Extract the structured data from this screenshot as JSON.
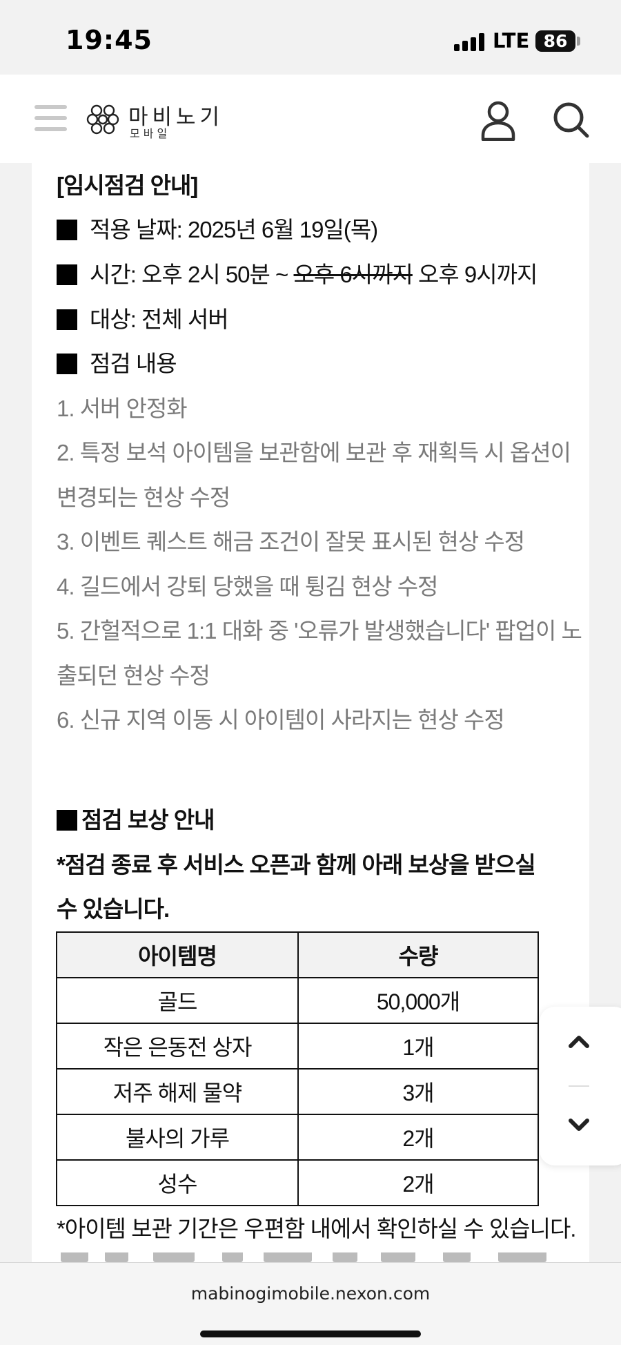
{
  "status": {
    "time": "19:45",
    "network": "LTE",
    "battery": "86"
  },
  "header": {
    "logo_title": "마비노기",
    "logo_subtitle": "모바일"
  },
  "notice": {
    "title": "[임시점검 안내]",
    "date_line": "적용 날짜: 2025년 6월 19일(목)",
    "time_prefix": "시간: 오후 2시 50분 ~ ",
    "time_struck": "오후 6시까지",
    "time_new": " 오후 9시까지",
    "target_line": "대상: 전체 서버",
    "content_heading": "점검 내용",
    "items": [
      "1. 서버 안정화",
      "2. 특정 보석 아이템을 보관함에 보관 후 재획득 시 옵션이",
      "변경되는 현상 수정",
      "3. 이벤트 퀘스트 해금 조건이 잘못 표시된 현상 수정",
      "4. 길드에서 강퇴 당했을 때 튕김 현상 수정",
      "5. 간헐적으로 1:1 대화 중 '오류가 발생했습니다' 팝업이 노",
      "출되던 현상 수정",
      "6. 신규 지역 이동 시 아이템이 사라지는 현상 수정"
    ]
  },
  "reward": {
    "heading": "점검 보상 안내",
    "note_line1": "*점검 종료 후 서비스 오픈과 함께 아래 보상을 받으실",
    "note_line2": "수 있습니다.",
    "table": {
      "headers": [
        "아이템명",
        "수량"
      ],
      "rows": [
        [
          "골드",
          "50,000개"
        ],
        [
          "작은 은동전 상자",
          "1개"
        ],
        [
          "저주 해제 물약",
          "3개"
        ],
        [
          "불사의 가루",
          "2개"
        ],
        [
          "성수",
          "2개"
        ]
      ]
    },
    "footnote": "*아이템 보관 기간은 우편함 내에서 확인하실 수 있습니다."
  },
  "browser": {
    "url": "mabinogimobile.nexon.com"
  }
}
